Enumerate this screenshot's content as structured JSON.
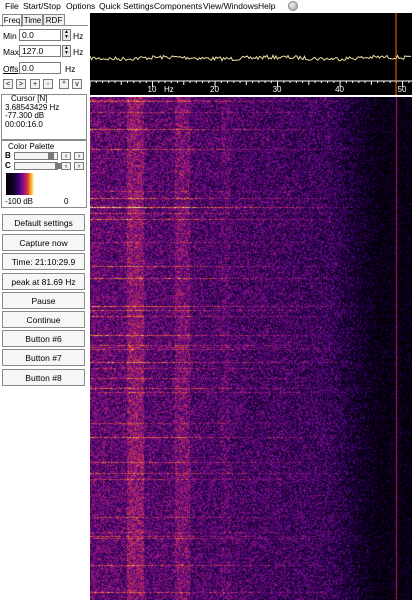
{
  "menu": {
    "items": [
      "File",
      "Start/Stop",
      "Options",
      "Quick Settings",
      "Components",
      "View/Windows",
      "Help"
    ],
    "underline_first": [
      "F",
      "S",
      "O",
      "Q",
      "C",
      "V",
      "H"
    ]
  },
  "tabs": [
    "Freq",
    "Time",
    "RDF"
  ],
  "freq_settings": {
    "min_label": "Min",
    "min_value": "0.0",
    "max_label": "Max",
    "max_value": "127.0",
    "offs_label": "Offs",
    "offs_value": "0.0",
    "unit": "Hz"
  },
  "zoom_buttons": [
    "<",
    ">",
    "+",
    "-",
    "^",
    "v"
  ],
  "cursor": {
    "title": "Cursor [N]",
    "frequency": "3.68543429 Hz",
    "level": "-77.300 dB",
    "time": "00:00:16.0"
  },
  "palette": {
    "title": "Color Palette",
    "b_label": "B",
    "c_label": "C",
    "scale_min": "-100 dB",
    "scale_max": "0"
  },
  "buttons": [
    "Default settings",
    "Capture now",
    "Time:  21:10:29.9",
    "peak at 81.69 Hz",
    "Pause",
    "Continue",
    "Button #6",
    "Button #7",
    "Button #8"
  ],
  "spectrum": {
    "axis_ticks": [
      "10",
      "20",
      "30",
      "40",
      "50"
    ],
    "axis_unit": "Hz",
    "xlim": [
      0,
      51.5
    ]
  },
  "colors": {
    "trace": "#e8e0a0",
    "axis": "#ffffff",
    "cursor_line": "#ff6a00"
  }
}
